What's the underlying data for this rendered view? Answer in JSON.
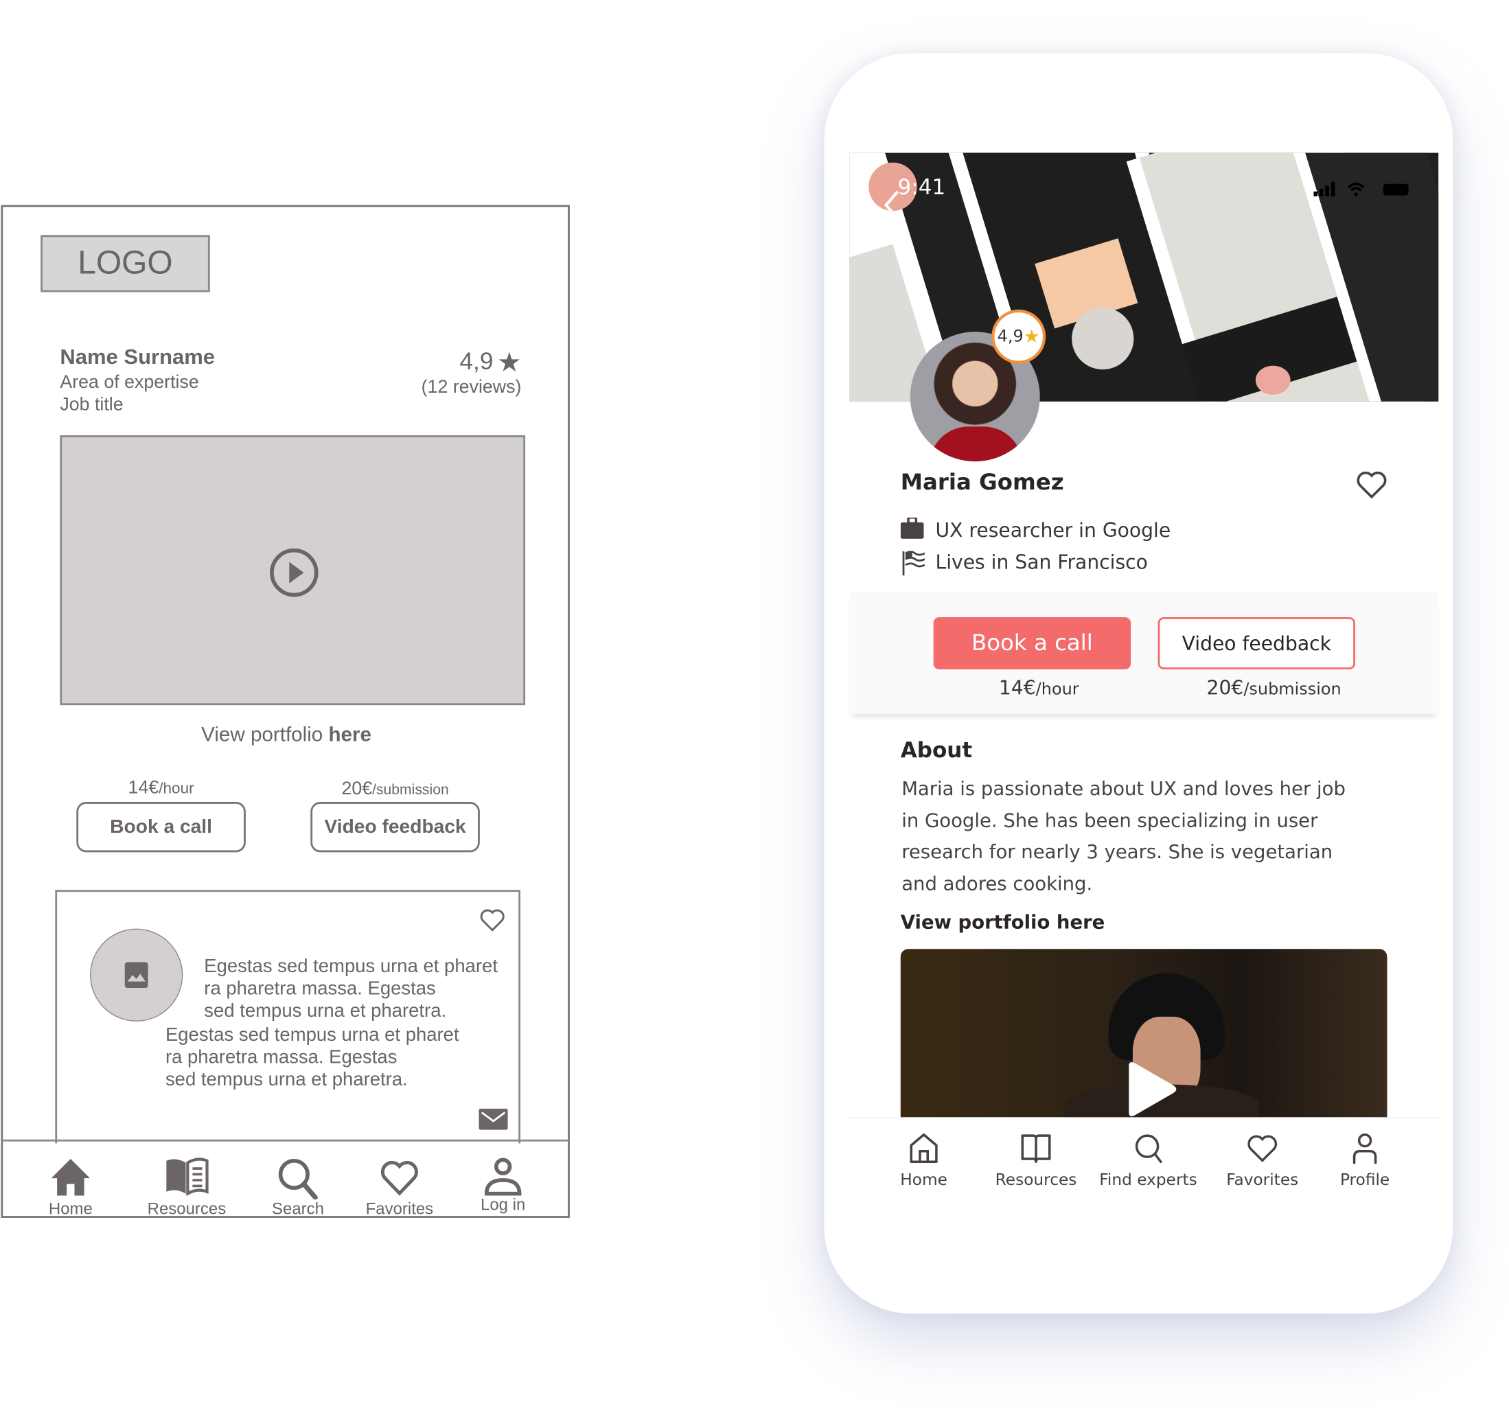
{
  "wireframe": {
    "logo": "LOGO",
    "name": "Name Surname",
    "area": "Area of expertise",
    "job": "Job title",
    "rating": "4,9",
    "reviews": "(12 reviews)",
    "portfolio_prefix": "View portfolio ",
    "portfolio_link": "here",
    "price_call": {
      "amount": "14€",
      "unit": "/hour"
    },
    "price_video": {
      "amount": "20€",
      "unit": "/submission"
    },
    "book_call": "Book a call",
    "video_feedback": "Video feedback",
    "card_para_1": [
      "Egestas sed tempus urna et pharet",
      "ra pharetra massa. Egestas",
      "sed tempus urna et pharetra."
    ],
    "card_para_2": [
      "Egestas sed tempus urna et pharet",
      "ra pharetra massa. Egestas",
      "sed tempus urna et pharetra."
    ],
    "nav": [
      {
        "label": "Home",
        "icon": "home-icon"
      },
      {
        "label": "Resources",
        "icon": "book-icon"
      },
      {
        "label": "Search",
        "icon": "search-icon"
      },
      {
        "label": "Favorites",
        "icon": "heart-icon"
      },
      {
        "label": "Log in",
        "icon": "user-icon"
      }
    ],
    "colors": {
      "ink": "#6b6565",
      "fill": "#d4d0cf"
    }
  },
  "phone": {
    "status_time": "9:41",
    "rating": "4,9",
    "name": "Maria Gomez",
    "job": "UX researcher in Google",
    "location": "Lives in San Francisco",
    "book_call": "Book a call",
    "video_feedback": "Video feedback",
    "price_call": {
      "amount": "14€",
      "unit": "/hour"
    },
    "price_video": {
      "amount": "20€",
      "unit": "/submission"
    },
    "about_title": "About",
    "about_lines": [
      "Maria is passionate about UX and loves her job",
      "in Google. She has been specializing in user",
      "research for nearly 3 years. She is vegetarian",
      "and adores cooking."
    ],
    "portfolio_link": "View portfolio here",
    "nav": [
      {
        "label": "Home",
        "icon": "home-icon"
      },
      {
        "label": "Resources",
        "icon": "book-icon"
      },
      {
        "label": "Find experts",
        "icon": "search-icon"
      },
      {
        "label": "Favorites",
        "icon": "heart-icon"
      },
      {
        "label": "Profile",
        "icon": "user-icon"
      }
    ],
    "colors": {
      "accent": "#f46b6b",
      "rating_ring": "#f0903a",
      "text": "#2a2424"
    }
  }
}
